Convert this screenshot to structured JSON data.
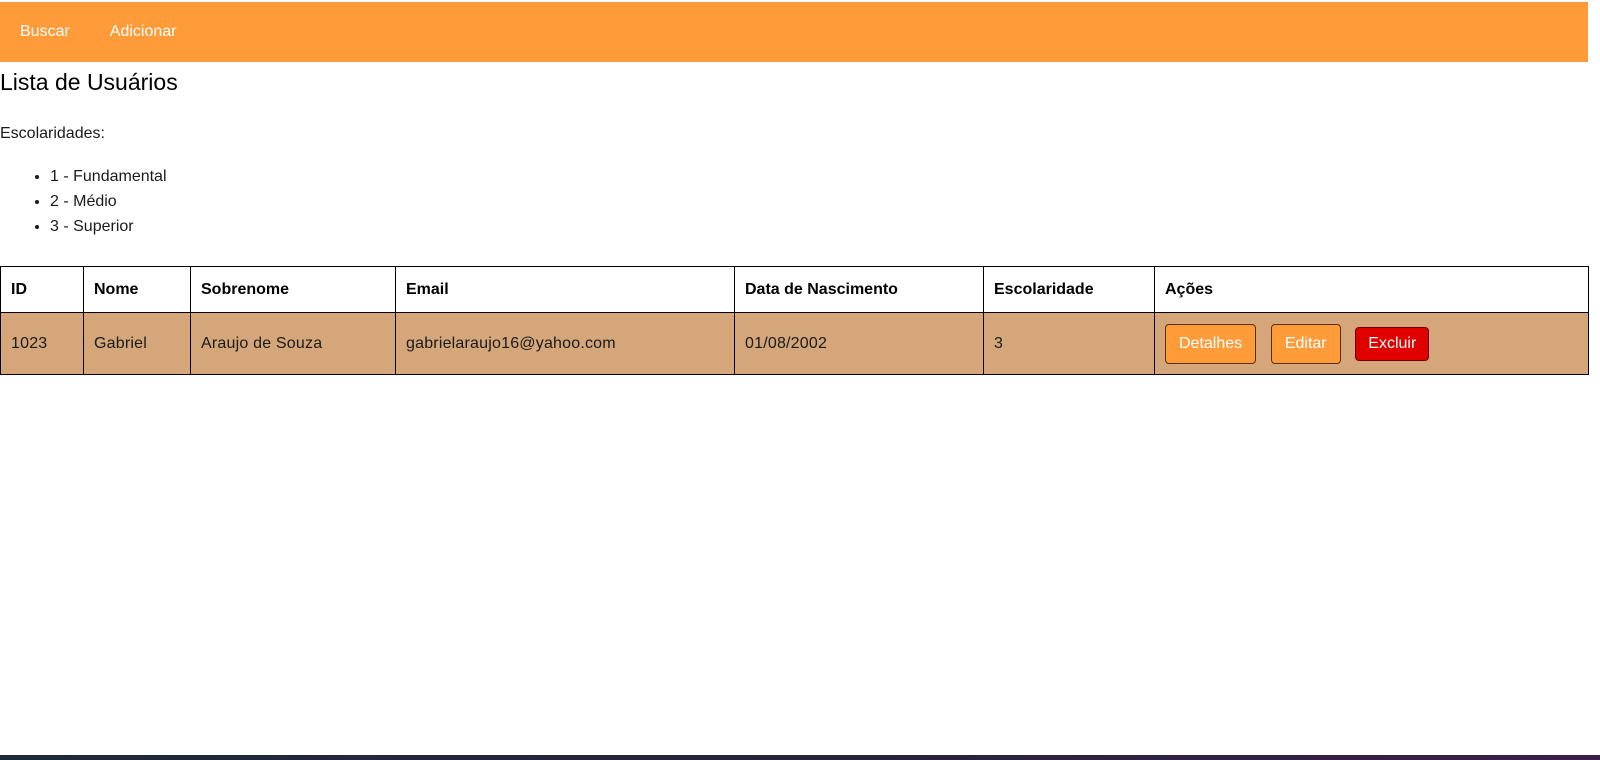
{
  "nav": {
    "search_label": "Buscar",
    "add_label": "Adicionar"
  },
  "page": {
    "title": "Lista de Usuários",
    "education_label": "Escolaridades:",
    "education_levels": [
      "1 - Fundamental",
      "2 - Médio",
      "3 - Superior"
    ]
  },
  "table": {
    "headers": [
      "ID",
      "Nome",
      "Sobrenome",
      "Email",
      "Data de Nascimento",
      "Escolaridade",
      "Ações"
    ],
    "rows": [
      {
        "id": "1023",
        "nome": "Gabriel",
        "sobrenome": "Araujo de Souza",
        "email": "gabrielaraujo16@yahoo.com",
        "nascimento": "01/08/2002",
        "escolaridade": "3"
      }
    ],
    "actions": {
      "details_label": "Detalhes",
      "edit_label": "Editar",
      "delete_label": "Excluir"
    }
  },
  "colors": {
    "accent": "#ff9b38",
    "row_background": "#d4a67a",
    "danger": "#e00000"
  }
}
